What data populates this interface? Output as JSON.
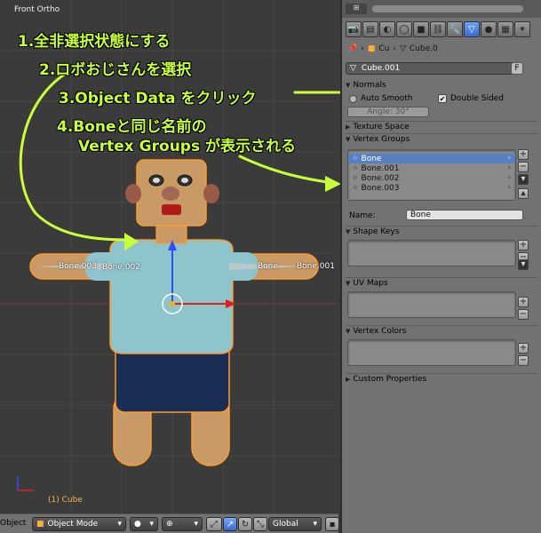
{
  "viewport": {
    "title": "Front Ortho",
    "object_label": "(1) Cube",
    "bone_labels": [
      "Bone.003",
      "Bone.002",
      "Bone",
      "Bone.001"
    ]
  },
  "annotations": {
    "step1": "1.全非選択状態にする",
    "step2": "2.ロボおじさんを選択",
    "step3": "3.Object Data をクリック",
    "step4_line1": "4.Boneと同じ名前の",
    "step4_line2": "Vertex Groups が表示される",
    "color": "#c8ff3a"
  },
  "header": {
    "object_menu": "Object",
    "mode": "Object Mode",
    "orientation": "Global"
  },
  "properties": {
    "breadcrumb_object": "Cu",
    "breadcrumb_mesh": "Cube.0",
    "mesh_name": "Cube.001",
    "fake_user": "F",
    "normals": {
      "title": "Normals",
      "auto_smooth": "Auto Smooth",
      "double_sided": "Double Sided",
      "angle": "Angle: 30°"
    },
    "texture_space": "Texture Space",
    "vertex_groups": {
      "title": "Vertex Groups",
      "items": [
        "Bone",
        "Bone.001",
        "Bone.002",
        "Bone.003"
      ],
      "name_label": "Name:",
      "name_value": "Bone"
    },
    "shape_keys": "Shape Keys",
    "uv_maps": "UV Maps",
    "vertex_colors": "Vertex Colors",
    "custom_properties": "Custom Properties"
  }
}
